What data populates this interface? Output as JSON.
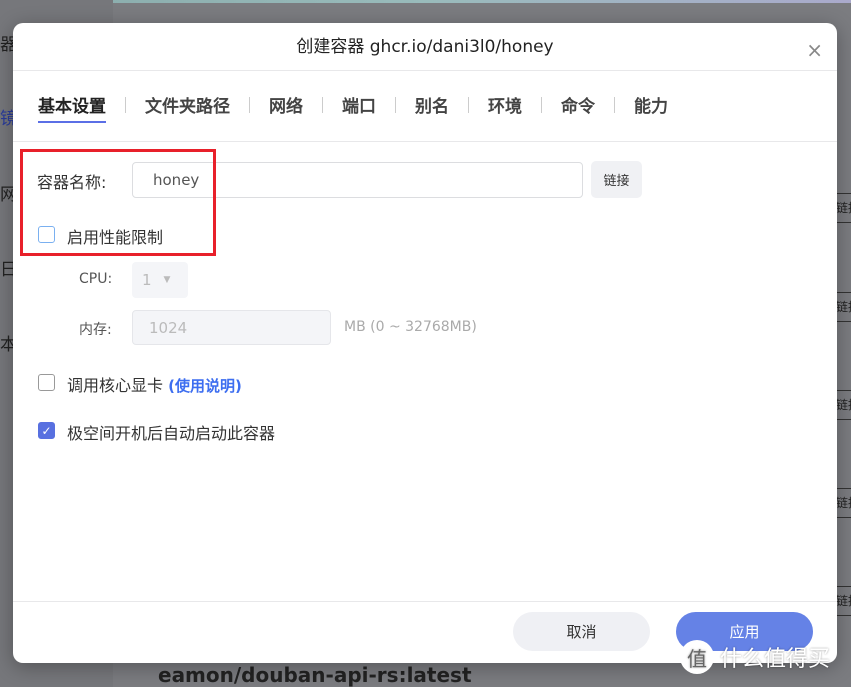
{
  "background": {
    "sidebar_fragments": [
      "器",
      "镜",
      "网",
      "日",
      "本"
    ],
    "row_button": "链接",
    "bottom_item": "eamon/douban-api-rs:latest"
  },
  "dialog": {
    "title": "创建容器 ghcr.io/dani3l0/honey",
    "close_icon": "×",
    "tabs": [
      {
        "label": "基本设置",
        "active": true
      },
      {
        "label": "文件夹路径"
      },
      {
        "label": "网络"
      },
      {
        "label": "端口"
      },
      {
        "label": "别名"
      },
      {
        "label": "环境"
      },
      {
        "label": "命令"
      },
      {
        "label": "能力"
      }
    ],
    "container_name": {
      "label": "容器名称:",
      "value": "honey",
      "link_button": "链接"
    },
    "perf_limit": {
      "label": "启用性能限制",
      "checked": false
    },
    "cpu": {
      "label": "CPU:",
      "value": "1"
    },
    "memory": {
      "label": "内存:",
      "value": "1024",
      "unit_hint": "MB (0 ~ 32768MB)"
    },
    "gpu": {
      "label": "调用核心显卡",
      "link": "(使用说明)",
      "checked": false
    },
    "autostart": {
      "label": "极空间开机后自动启动此容器",
      "checked": true
    },
    "cancel": "取消",
    "apply": "应用"
  },
  "watermark": {
    "logo": "值",
    "text": "什么值得买"
  },
  "colors": {
    "accent": "#5b6fe6",
    "highlight_box": "#e8202a",
    "link": "#3d6ef0"
  }
}
